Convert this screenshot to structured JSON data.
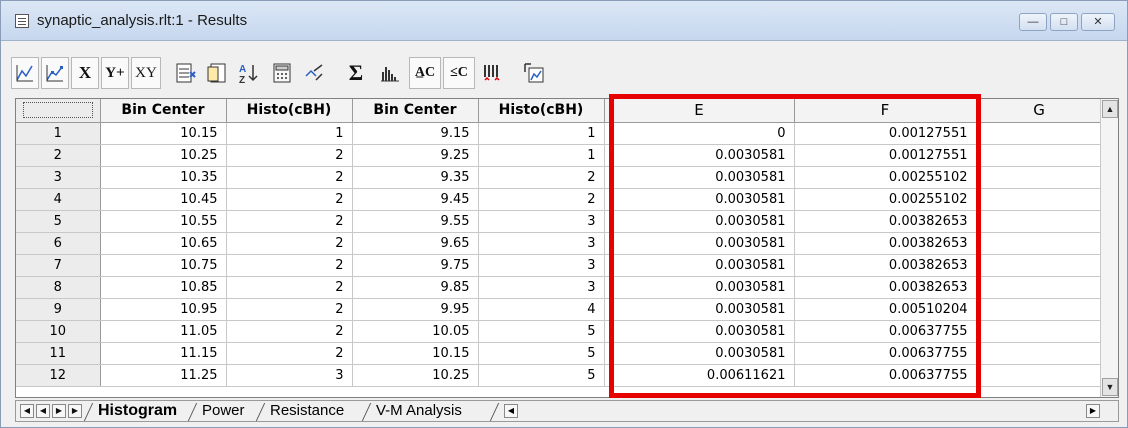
{
  "window": {
    "title": "synaptic_analysis.rlt:1 - Results",
    "min_label": "—",
    "max_label": "□",
    "close_label": "✕"
  },
  "toolbar": {
    "x_label": "X",
    "yplus_label": "Y+",
    "xy_label": "XY",
    "sigma_label": "Σ",
    "ac_label": "A̲C",
    "ac2_label": "≤C"
  },
  "table": {
    "columns": [
      "Bin Center",
      "Histo(cBH)",
      "Bin Center",
      "Histo(cBH)",
      "E",
      "F",
      "G"
    ],
    "rows": [
      {
        "n": "1",
        "c1": "10.15",
        "c2": "1",
        "c3": "9.15",
        "c4": "1",
        "e": "0",
        "f": "0.00127551"
      },
      {
        "n": "2",
        "c1": "10.25",
        "c2": "2",
        "c3": "9.25",
        "c4": "1",
        "e": "0.0030581",
        "f": "0.00127551"
      },
      {
        "n": "3",
        "c1": "10.35",
        "c2": "2",
        "c3": "9.35",
        "c4": "2",
        "e": "0.0030581",
        "f": "0.00255102"
      },
      {
        "n": "4",
        "c1": "10.45",
        "c2": "2",
        "c3": "9.45",
        "c4": "2",
        "e": "0.0030581",
        "f": "0.00255102"
      },
      {
        "n": "5",
        "c1": "10.55",
        "c2": "2",
        "c3": "9.55",
        "c4": "3",
        "e": "0.0030581",
        "f": "0.00382653"
      },
      {
        "n": "6",
        "c1": "10.65",
        "c2": "2",
        "c3": "9.65",
        "c4": "3",
        "e": "0.0030581",
        "f": "0.00382653"
      },
      {
        "n": "7",
        "c1": "10.75",
        "c2": "2",
        "c3": "9.75",
        "c4": "3",
        "e": "0.0030581",
        "f": "0.00382653"
      },
      {
        "n": "8",
        "c1": "10.85",
        "c2": "2",
        "c3": "9.85",
        "c4": "3",
        "e": "0.0030581",
        "f": "0.00382653"
      },
      {
        "n": "9",
        "c1": "10.95",
        "c2": "2",
        "c3": "9.95",
        "c4": "4",
        "e": "0.0030581",
        "f": "0.00510204"
      },
      {
        "n": "10",
        "c1": "11.05",
        "c2": "2",
        "c3": "10.05",
        "c4": "5",
        "e": "0.0030581",
        "f": "0.00637755"
      },
      {
        "n": "11",
        "c1": "11.15",
        "c2": "2",
        "c3": "10.15",
        "c4": "5",
        "e": "0.0030581",
        "f": "0.00637755"
      },
      {
        "n": "12",
        "c1": "11.25",
        "c2": "3",
        "c3": "10.25",
        "c4": "5",
        "e": "0.00611621",
        "f": "0.00637755"
      }
    ]
  },
  "tabs": [
    "Histogram",
    "Power",
    "Resistance",
    "V-M Analysis"
  ],
  "active_tab": "Histogram",
  "highlight_color": "#e60000"
}
